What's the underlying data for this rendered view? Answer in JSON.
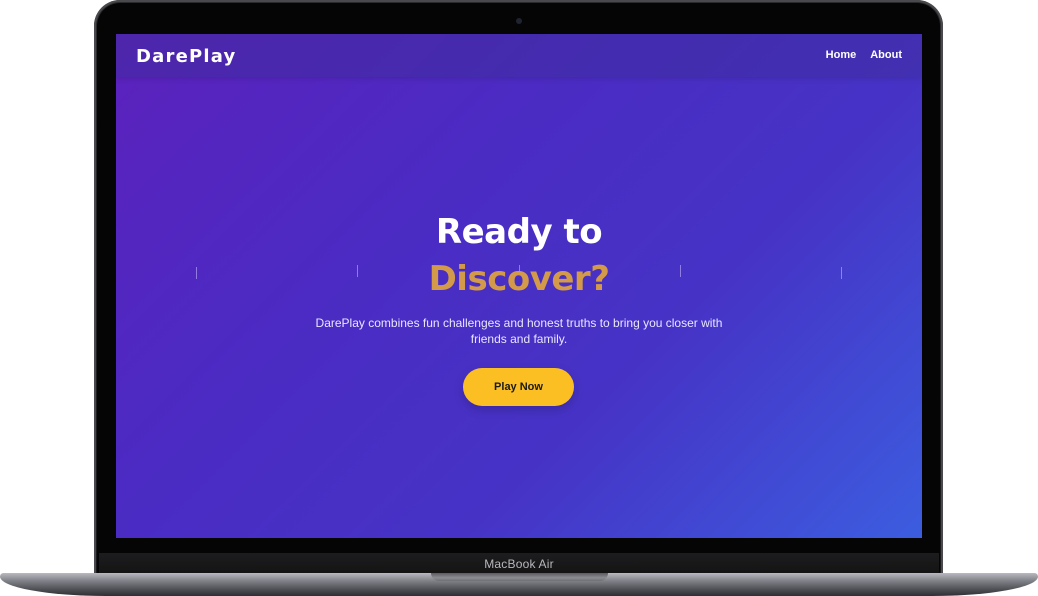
{
  "device": {
    "label": "MacBook Air"
  },
  "site": {
    "brand": "DarePlay",
    "nav": {
      "home": "Home",
      "about": "About"
    },
    "hero": {
      "title_line1": "Ready to",
      "title_line2": "Discover?",
      "description": "DarePlay combines fun challenges and honest truths to bring you closer with friends and family.",
      "cta": "Play Now"
    }
  },
  "colors": {
    "gradient_start": "#5c21bd",
    "gradient_end": "#3c5ddf",
    "accent_text": "#d39a4a",
    "cta_background": "#fbbf24"
  }
}
